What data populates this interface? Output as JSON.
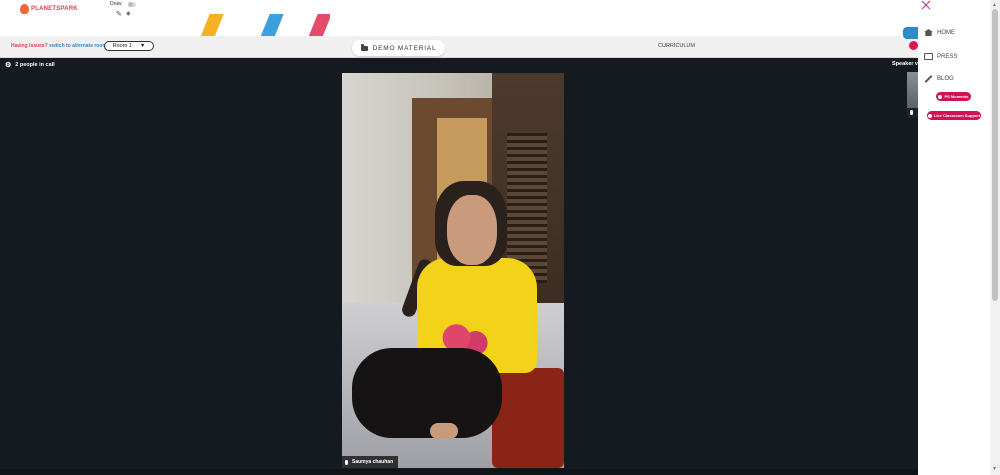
{
  "header": {
    "logo_text": "PLANETSPARK",
    "draw_label": "Draw"
  },
  "toolbar": {
    "issues_question": "Having issues?",
    "issues_action": "switch to alternate room",
    "room_label": "Room 1",
    "room_caret": "▼",
    "demo_material_label": "DEMO MATERIAL",
    "curriculum_label": "CURRICULUM"
  },
  "call": {
    "people_count_text": "2 people in call",
    "speaker_view_label": "Speaker v",
    "participant_name": "Saumya chauhan"
  },
  "side_menu": {
    "items": [
      {
        "label": "HOME",
        "icon": "home-icon"
      },
      {
        "label": "PRESS",
        "icon": "press-icon"
      },
      {
        "label": "BLOG",
        "icon": "blog-icon"
      }
    ],
    "pill_moments": "PS Moments",
    "pill_support": "Live Classroom Support"
  },
  "colors": {
    "brand_red": "#e23b54",
    "pill_pink": "#d01256",
    "call_bg": "#141a20",
    "link_blue": "#3b86c7"
  }
}
